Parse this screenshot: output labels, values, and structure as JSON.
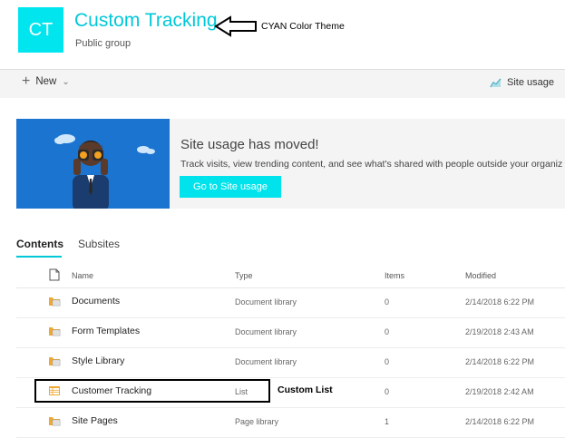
{
  "site": {
    "logo_initials": "CT",
    "title": "Custom Tracking",
    "subtitle": "Public group"
  },
  "annotations": {
    "theme_note": "CYAN Color Theme",
    "custom_list_note": "Custom List"
  },
  "commandbar": {
    "new_label": "New",
    "site_usage_label": "Site usage"
  },
  "banner": {
    "title": "Site usage has moved!",
    "description": "Track visits, view trending content, and see what's shared with people outside your organiz",
    "button_label": "Go to Site usage"
  },
  "tabs": [
    {
      "label": "Contents",
      "active": true
    },
    {
      "label": "Subsites",
      "active": false
    }
  ],
  "table": {
    "headers": {
      "name": "Name",
      "type": "Type",
      "items": "Items",
      "modified": "Modified"
    },
    "rows": [
      {
        "name": "Documents",
        "type": "Document library",
        "items": "0",
        "modified": "2/14/2018 6:22 PM",
        "icon": "library-icon"
      },
      {
        "name": "Form Templates",
        "type": "Document library",
        "items": "0",
        "modified": "2/19/2018 2:43 AM",
        "icon": "library-icon"
      },
      {
        "name": "Style Library",
        "type": "Document library",
        "items": "0",
        "modified": "2/14/2018 6:22 PM",
        "icon": "library-icon"
      },
      {
        "name": "Customer Tracking",
        "type": "List",
        "items": "0",
        "modified": "2/19/2018 2:42 AM",
        "icon": "list-icon"
      },
      {
        "name": "Site Pages",
        "type": "Page library",
        "items": "1",
        "modified": "2/14/2018 6:22 PM",
        "icon": "library-icon"
      }
    ]
  },
  "colors": {
    "theme_cyan": "#00e5ee",
    "title_cyan": "#00c8d8",
    "banner_blue": "#1b74cf",
    "folder_orange": "#f0a830"
  }
}
